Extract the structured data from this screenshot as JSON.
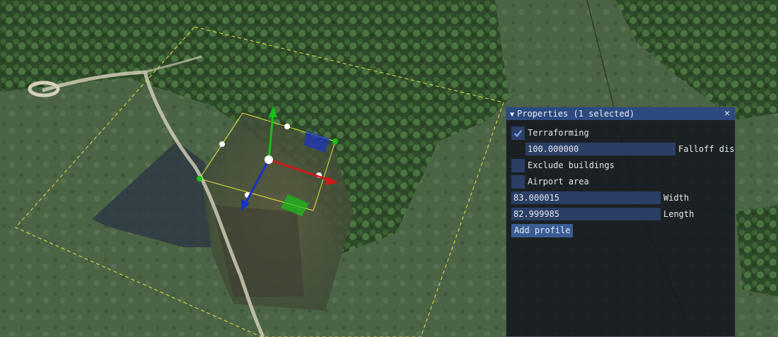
{
  "panel": {
    "title": "Properties (1 selected)",
    "collapse_glyph": "▼",
    "close_glyph": "✕",
    "terraforming": {
      "label": "Terraforming",
      "checked": true
    },
    "falloff": {
      "value": "100.000000",
      "label": "Falloff dis"
    },
    "exclude_buildings": {
      "label": "Exclude buildings",
      "checked": false
    },
    "airport_area": {
      "label": "Airport area",
      "checked": false
    },
    "width": {
      "value": "83.000015",
      "label": "Width"
    },
    "length": {
      "value": "82.999985",
      "label": "Length"
    },
    "add_profile_label": "Add profile"
  },
  "icons": {
    "collapse": "triangle-down-icon",
    "close": "close-icon",
    "check": "checkmark-icon"
  },
  "colors": {
    "title_bar": "#2c4a7f",
    "field_bg": "#2b3e66",
    "button_bg": "#3a5c94",
    "gizmo_x": "#d01818",
    "gizmo_y": "#18c018",
    "gizmo_z": "#1830c8",
    "selection": "#e8e040"
  }
}
